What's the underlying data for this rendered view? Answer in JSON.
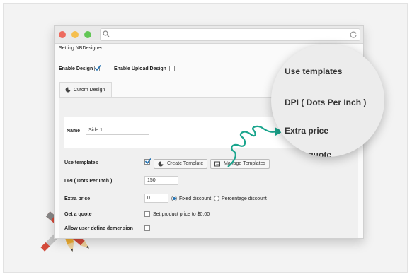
{
  "page": {
    "title": "Setting NBDesigner",
    "enable_design_label": "Enable Design",
    "enable_design_checked": true,
    "enable_upload_label": "Enable Upload Design",
    "enable_upload_checked": false,
    "tab_label": "Cutom Design"
  },
  "form": {
    "name_label": "Name",
    "name_value": "Side 1",
    "use_templates_label": "Use templates",
    "create_template_button": "Create Template",
    "manage_templates_button": "Manage Templates",
    "dpi_label": "DPI ( Dots Per Inch )",
    "dpi_value": "150",
    "extra_price_label": "Extra price",
    "extra_price_value": "0",
    "fixed_discount_label": "Fixed discount",
    "percentage_discount_label": "Percentage discount",
    "get_quote_label": "Get a quote",
    "set_price_label": "Set product price to $0.00",
    "allow_dimension_label": "Allow user define demension"
  },
  "magnifier": {
    "items": [
      "Use templates",
      "DPI ( Dots Per Inch )",
      "Extra price",
      "Get a quote"
    ]
  },
  "colors": {
    "accent": "#2271b1",
    "arrow": "#1aa58d",
    "close": "#ed6a5e",
    "minimize": "#f5bf4f",
    "maximize": "#62c655"
  }
}
